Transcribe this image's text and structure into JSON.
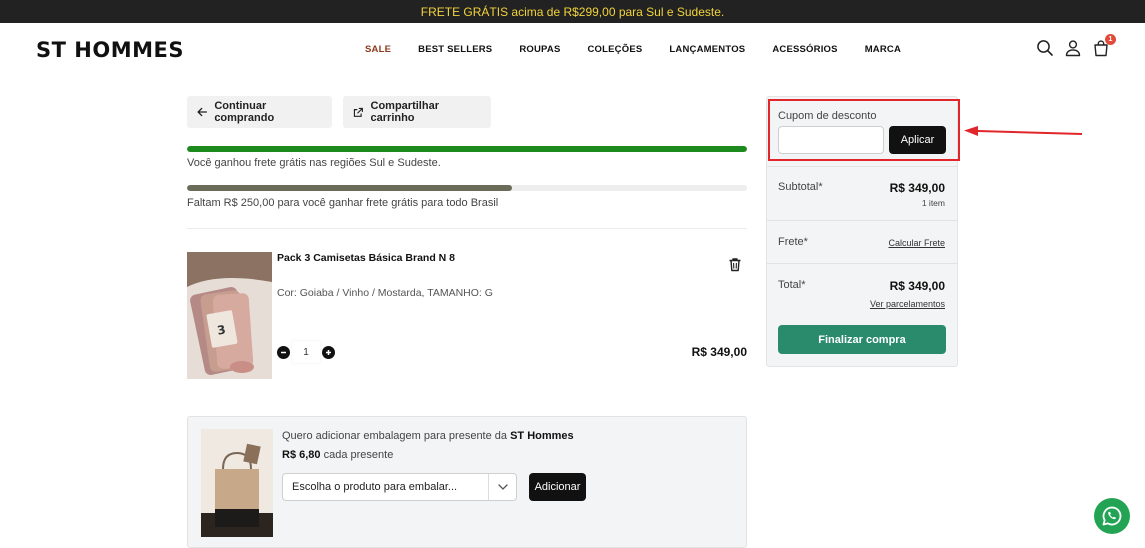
{
  "topbar": {
    "text": "FRETE GRÁTIS acima de R$299,00 para Sul e Sudeste."
  },
  "header": {
    "logo": "ST HOMMES",
    "nav": [
      "SALE",
      "BEST SELLERS",
      "ROUPAS",
      "COLEÇÕES",
      "LANÇAMENTOS",
      "ACESSÓRIOS",
      "MARCA"
    ],
    "cart_count": "1"
  },
  "actions": {
    "continue_label": "Continuar comprando",
    "share_label": "Compartilhar carrinho"
  },
  "shipping": {
    "region_text": "Você ganhou frete grátis nas regiões Sul e Sudeste.",
    "region_progress": 1.0,
    "brazil_text": "Faltam R$ 250,00 para você ganhar frete grátis para todo Brasil",
    "brazil_progress": 0.58
  },
  "product": {
    "name": "Pack 3 Camisetas Básica Brand N 8",
    "variant": "Cor: Goiaba / Vinho / Mostarda, TAMANHO: G",
    "quantity": "1",
    "price": "R$ 349,00"
  },
  "gift": {
    "title_prefix": "Quero adicionar embalagem para presente da",
    "brand": "ST Hommes",
    "price": "R$ 6,80",
    "price_suffix": "cada presente",
    "select_placeholder": "Escolha o produto para embalar...",
    "add_label": "Adicionar"
  },
  "summary": {
    "coupon_label": "Cupom de desconto",
    "coupon_value": "",
    "apply_label": "Aplicar",
    "subtotal_label": "Subtotal*",
    "subtotal_value": "R$ 349,00",
    "subtotal_items": "1 item",
    "shipping_label": "Frete*",
    "shipping_link": "Calcular Frete",
    "total_label": "Total*",
    "total_value": "R$ 349,00",
    "installments_link": "Ver parcelamentos",
    "checkout_label": "Finalizar compra"
  },
  "colors": {
    "topbar_bg": "#222222",
    "topbar_text": "#f2d33b",
    "progress_green": "#1c8a1c",
    "progress_olive": "#6b6b5a",
    "checkout": "#2a8b6c",
    "highlight": "#e0262a",
    "whatsapp": "#23a455"
  },
  "icons": [
    "search-icon",
    "user-icon",
    "bag-icon",
    "arrow-left-icon",
    "share-icon",
    "trash-icon",
    "minus-icon",
    "plus-icon",
    "chevron-down-icon",
    "whatsapp-icon"
  ]
}
